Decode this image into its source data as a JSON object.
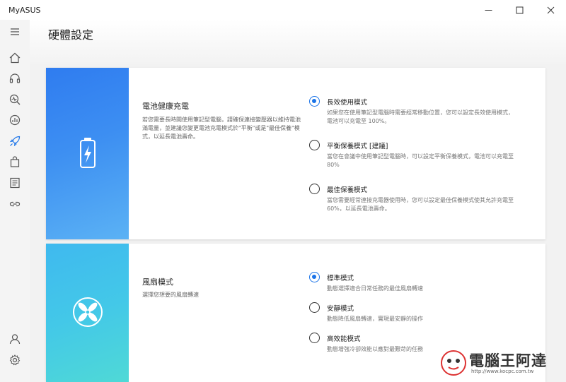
{
  "window": {
    "title": "MyASUS"
  },
  "sidebar": {
    "items": [
      {
        "icon": "menu-icon"
      },
      {
        "icon": "home-icon"
      },
      {
        "icon": "headset-icon"
      },
      {
        "icon": "diagnostics-icon"
      },
      {
        "icon": "system-monitor-icon"
      },
      {
        "icon": "rocket-icon"
      },
      {
        "icon": "shopping-bag-icon"
      },
      {
        "icon": "news-icon"
      },
      {
        "icon": "link-icon"
      },
      {
        "icon": "user-icon"
      },
      {
        "icon": "gear-icon"
      }
    ],
    "active_icon": "rocket-icon"
  },
  "header": {
    "title": "硬體設定"
  },
  "battery": {
    "title": "電池健康充電",
    "description": "若您需要長時間使用筆記型電腦，請確保連接變壓器以維持電池滿電量，並建議您變更電池充電模式於\"平衡\"或是\"最佳保養\"模式，以延長電池壽命。",
    "options": [
      {
        "label": "長效使用模式",
        "desc": "如果您在使用筆記型電腦時需要經常移動位置，您可以設定長效使用模式，電池可以充電至 100%。",
        "selected": true
      },
      {
        "label": "平衡保養模式 [建議]",
        "desc": "當您在會議中使用筆記型電腦時，可以設定平衡保養模式，電池可以充電至 80%",
        "selected": false
      },
      {
        "label": "最佳保養模式",
        "desc": "當您需要經常連接充電器使用時，您可以設定最佳保養模式使其允許充電至60%，以延長電池壽命。",
        "selected": false
      }
    ]
  },
  "fan": {
    "title": "風扇模式",
    "description": "選擇您想要的風扇轉速",
    "options": [
      {
        "label": "標準模式",
        "desc": "動態選擇適合日常任務的最佳風扇轉速",
        "selected": true
      },
      {
        "label": "安靜模式",
        "desc": "動態降低風扇轉速，實現最安靜的操作",
        "selected": false
      },
      {
        "label": "高效能模式",
        "desc": "動態增強冷卻效能以應對最艱苛的任務",
        "selected": false
      }
    ]
  },
  "watermark": {
    "text": "電腦王阿達",
    "url": "http://www.kocpc.com.tw"
  },
  "colors": {
    "accent": "#1a73e8",
    "battery_gradient_top": "#2f7cf0",
    "fan_gradient_top": "#3fb9ef"
  }
}
